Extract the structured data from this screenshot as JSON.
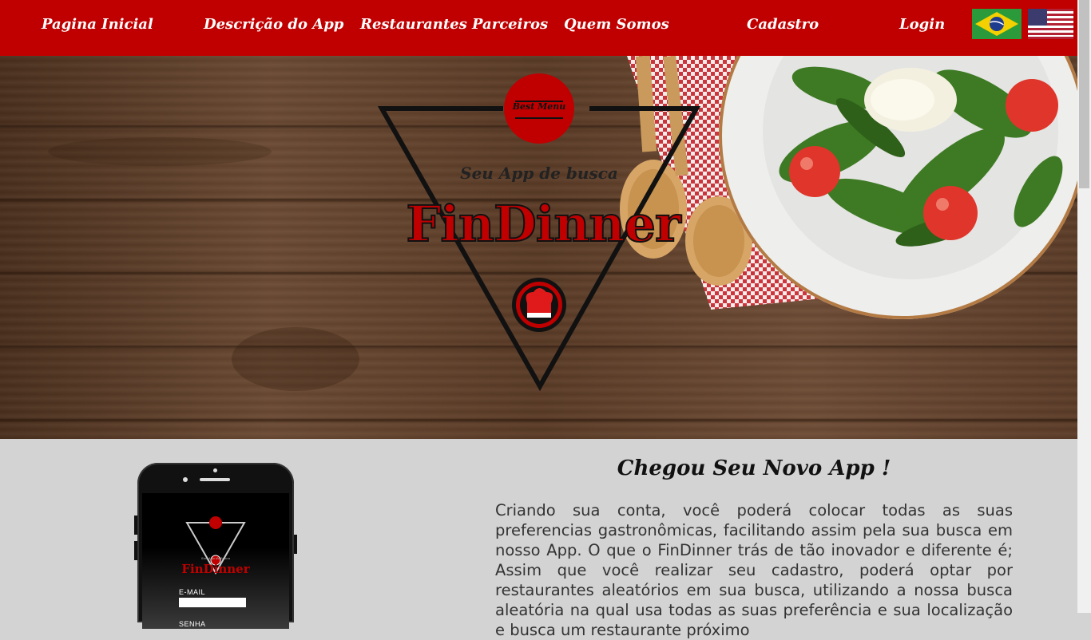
{
  "nav": {
    "items": [
      {
        "label": "Pagina Inicial"
      },
      {
        "label": "Descrição do App"
      },
      {
        "label": "Restaurantes Parceiros"
      },
      {
        "label": "Quem Somos"
      },
      {
        "label": "Cadastro"
      },
      {
        "label": "Login"
      }
    ],
    "flags": [
      "brazil-flag-icon",
      "usa-flag-icon"
    ]
  },
  "hero": {
    "badge_text": "Best Menu",
    "tagline": "Seu App de busca",
    "brand": "FinDinner"
  },
  "phone": {
    "logo_sub": "Seu App de busca",
    "logo_title": "FinDinner",
    "email_label": "E-MAIL",
    "password_label": "SENHA"
  },
  "content": {
    "title": "Chegou Seu Novo App !",
    "body": "Criando sua conta, você poderá colocar todas as suas preferencias gastronômicas, facilitando assim pela sua busca em nosso App. O que o FinDinner trás de tão inovador e diferente é; Assim que você realizar seu cadastro, poderá optar por restaurantes aleatórios em sua busca, utilizando a nossa busca aleatória na qual usa todas as suas preferência e sua localização e busca um restaurante próximo"
  },
  "colors": {
    "brand_red": "#c00000",
    "page_bg": "#d3d3d3"
  }
}
